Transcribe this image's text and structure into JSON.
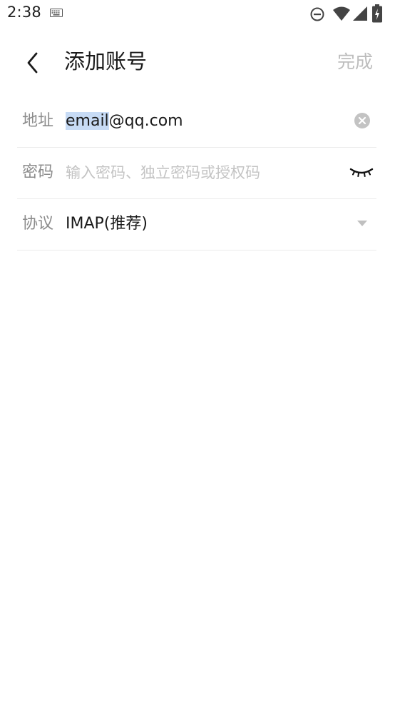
{
  "status_bar": {
    "time": "2:38",
    "icons": [
      "keyboard-icon",
      "do-not-disturb-icon",
      "wifi-icon",
      "cellular-icon",
      "battery-charging-icon"
    ]
  },
  "app_bar": {
    "title": "添加账号",
    "done_label": "完成",
    "back_icon": "chevron-left-icon"
  },
  "form": {
    "address": {
      "label": "地址",
      "value_selected": "email",
      "value_rest": "@qq.com",
      "trailing_icon": "clear-icon"
    },
    "password": {
      "label": "密码",
      "placeholder": "输入密码、独立密码或授权码",
      "trailing_icon": "eye-closed-icon"
    },
    "protocol": {
      "label": "协议",
      "value": "IMAP(推荐)",
      "trailing_icon": "dropdown-arrow-icon"
    }
  },
  "colors": {
    "background": "#ffffff",
    "label": "#8c8c8c",
    "placeholder": "#c4c4c4",
    "done_disabled": "#bdbdbd",
    "selection": "#c7dbf5",
    "divider": "#ececec"
  }
}
